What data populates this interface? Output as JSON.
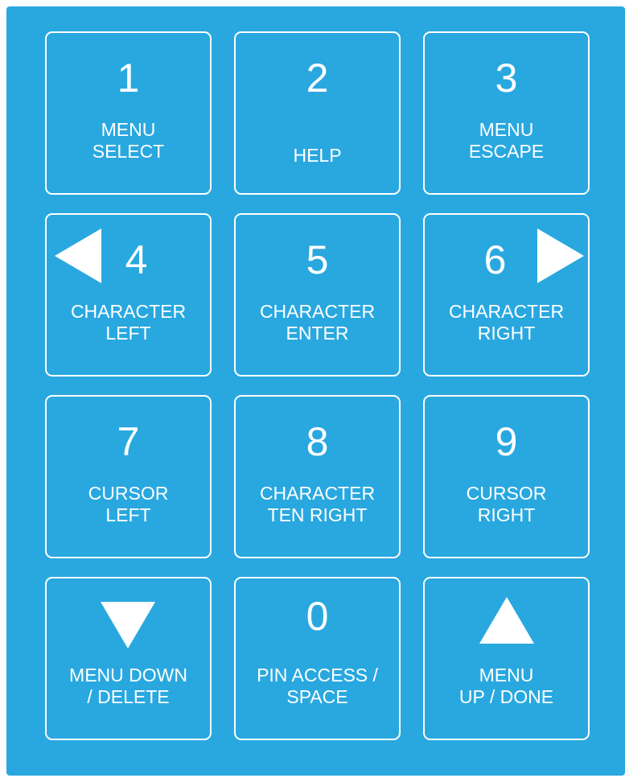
{
  "colors": {
    "panel_background": "#29a8e0",
    "key_border": "#ffffff",
    "text": "#ffffff"
  },
  "keypad": {
    "keys": [
      {
        "digit": "1",
        "line1": "MENU",
        "line2": "SELECT"
      },
      {
        "digit": "2",
        "line1": "",
        "line2": "HELP"
      },
      {
        "digit": "3",
        "line1": "MENU",
        "line2": "ESCAPE"
      },
      {
        "digit": "4",
        "line1": "CHARACTER",
        "line2": "LEFT",
        "icon": "left-arrow-icon"
      },
      {
        "digit": "5",
        "line1": "CHARACTER",
        "line2": "ENTER"
      },
      {
        "digit": "6",
        "line1": "CHARACTER",
        "line2": "RIGHT",
        "icon": "right-arrow-icon"
      },
      {
        "digit": "7",
        "line1": "CURSOR",
        "line2": "LEFT"
      },
      {
        "digit": "8",
        "line1": "CHARACTER",
        "line2": "TEN RIGHT"
      },
      {
        "digit": "9",
        "line1": "CURSOR",
        "line2": "RIGHT"
      },
      {
        "digit": "",
        "line1": "MENU DOWN",
        "line2": "/ DELETE",
        "icon": "down-arrow-icon"
      },
      {
        "digit": "0",
        "line1": "PIN ACCESS /",
        "line2": "SPACE"
      },
      {
        "digit": "",
        "line1": "MENU",
        "line2": "UP / DONE",
        "icon": "up-arrow-icon"
      }
    ]
  }
}
